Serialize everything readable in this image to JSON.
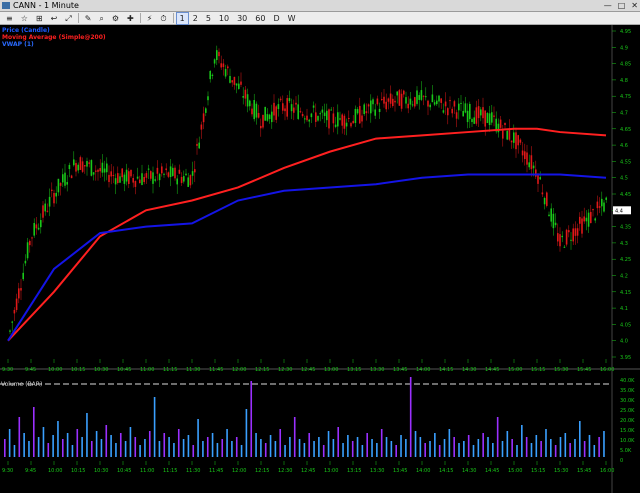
{
  "window": {
    "title": "CANN - 1 Minute",
    "min": "—",
    "max": "□",
    "close": "✕"
  },
  "toolbar": {
    "items": [
      "≡",
      "☆",
      "⊞",
      "↩",
      "⤢",
      "✎",
      "⌕",
      "⚙",
      "✚",
      "⚡",
      "⏱"
    ],
    "intervals": [
      "1",
      "2",
      "5",
      "10",
      "30",
      "60",
      "D",
      "W"
    ],
    "selected_interval": "1"
  },
  "legend": [
    {
      "label": "Price (Candle)",
      "color": "#1e5bff"
    },
    {
      "label": "Moving Average (Simple@200)",
      "color": "#ff2020"
    },
    {
      "label": "VWAP (1)",
      "color": "#2a6bff"
    }
  ],
  "price_axis": {
    "labels": [
      "4.95",
      "4.9",
      "4.85",
      "4.8",
      "4.75",
      "4.7",
      "4.65",
      "4.6",
      "4.55",
      "4.5",
      "4.45",
      "4.4",
      "4.35",
      "4.3",
      "4.25",
      "4.2",
      "4.15",
      "4.1",
      "4.05",
      "4.0",
      "3.95"
    ],
    "current_price": "4.4"
  },
  "time_axis": {
    "labels": [
      "9:30",
      "9:45",
      "10:00",
      "10:15",
      "10:30",
      "10:45",
      "11:00",
      "11:15",
      "11:30",
      "11:45",
      "12:00",
      "12:15",
      "12:30",
      "12:45",
      "13:00",
      "13:15",
      "13:30",
      "13:45",
      "14:00",
      "14:15",
      "14:30",
      "14:45",
      "15:00",
      "15:15",
      "15:30",
      "15:45",
      "16:00"
    ]
  },
  "volume_panel": {
    "title": "Volume (BAR)",
    "labels": [
      "40.0K",
      "35.0K",
      "30.0K",
      "25.0K",
      "20.0K",
      "15.0K",
      "10.0K",
      "5.0K",
      "0"
    ]
  },
  "colors": {
    "up": "#19c819",
    "down": "#e01818",
    "ma": "#ff2020",
    "vwap": "#1414e6",
    "axis": "#19c819",
    "vol_a": "#3aa0ff",
    "vol_b": "#9b30ff"
  },
  "chart_data": {
    "type": "line",
    "series": [
      {
        "name": "Moving Average (Simple@200)",
        "x": [
          "9:30",
          "10:00",
          "10:30",
          "11:00",
          "11:30",
          "12:00",
          "12:30",
          "13:00",
          "13:30",
          "14:00",
          "14:30",
          "15:00",
          "15:15",
          "15:30",
          "16:00"
        ],
        "values": [
          4.0,
          4.15,
          4.32,
          4.4,
          4.43,
          4.47,
          4.53,
          4.58,
          4.62,
          4.63,
          4.64,
          4.65,
          4.65,
          4.64,
          4.63
        ]
      },
      {
        "name": "VWAP (1)",
        "x": [
          "9:30",
          "10:00",
          "10:30",
          "11:00",
          "11:30",
          "12:00",
          "12:30",
          "13:00",
          "13:30",
          "14:00",
          "14:30",
          "15:00",
          "15:15",
          "15:30",
          "16:00"
        ],
        "values": [
          4.0,
          4.22,
          4.33,
          4.35,
          4.36,
          4.43,
          4.46,
          4.47,
          4.48,
          4.5,
          4.51,
          4.51,
          4.51,
          4.51,
          4.5
        ]
      },
      {
        "name": "Price (Candle)",
        "x": [
          "9:30",
          "9:45",
          "10:00",
          "10:15",
          "10:30",
          "10:45",
          "11:00",
          "11:15",
          "11:30",
          "11:45",
          "12:00",
          "12:15",
          "12:30",
          "12:45",
          "13:00",
          "13:15",
          "13:30",
          "13:45",
          "14:00",
          "14:15",
          "14:30",
          "14:45",
          "15:00",
          "15:15",
          "15:30",
          "15:45",
          "16:00"
        ],
        "values": [
          4.0,
          4.32,
          4.45,
          4.55,
          4.52,
          4.5,
          4.5,
          4.51,
          4.5,
          4.88,
          4.78,
          4.68,
          4.72,
          4.7,
          4.68,
          4.68,
          4.72,
          4.74,
          4.74,
          4.72,
          4.7,
          4.68,
          4.62,
          4.52,
          4.3,
          4.36,
          4.42
        ]
      }
    ],
    "ylim": [
      3.95,
      4.95
    ],
    "volume": [
      9,
      14,
      6,
      20,
      12,
      8,
      25,
      10,
      15,
      7,
      11,
      18,
      9,
      12,
      6,
      14,
      10,
      22,
      8,
      13,
      9,
      16,
      11,
      7,
      12,
      8,
      15,
      10,
      6,
      9,
      13,
      30,
      8,
      12,
      10,
      7,
      14,
      9,
      11,
      6,
      19,
      8,
      10,
      12,
      7,
      9,
      14,
      8,
      10,
      6,
      24,
      38,
      12,
      9,
      7,
      11,
      8,
      14,
      6,
      10,
      20,
      9,
      7,
      12,
      8,
      10,
      6,
      13,
      9,
      15,
      7,
      11,
      8,
      10,
      6,
      12,
      9,
      7,
      14,
      10,
      8,
      6,
      11,
      9,
      40,
      13,
      10,
      7,
      8,
      12,
      6,
      9,
      14,
      10,
      7,
      8,
      11,
      6,
      9,
      12,
      10,
      7,
      20,
      8,
      13,
      9,
      6,
      16,
      10,
      7,
      11,
      8,
      14,
      9,
      6,
      10,
      12,
      7,
      9,
      18,
      8,
      11,
      6,
      10,
      13
    ]
  }
}
